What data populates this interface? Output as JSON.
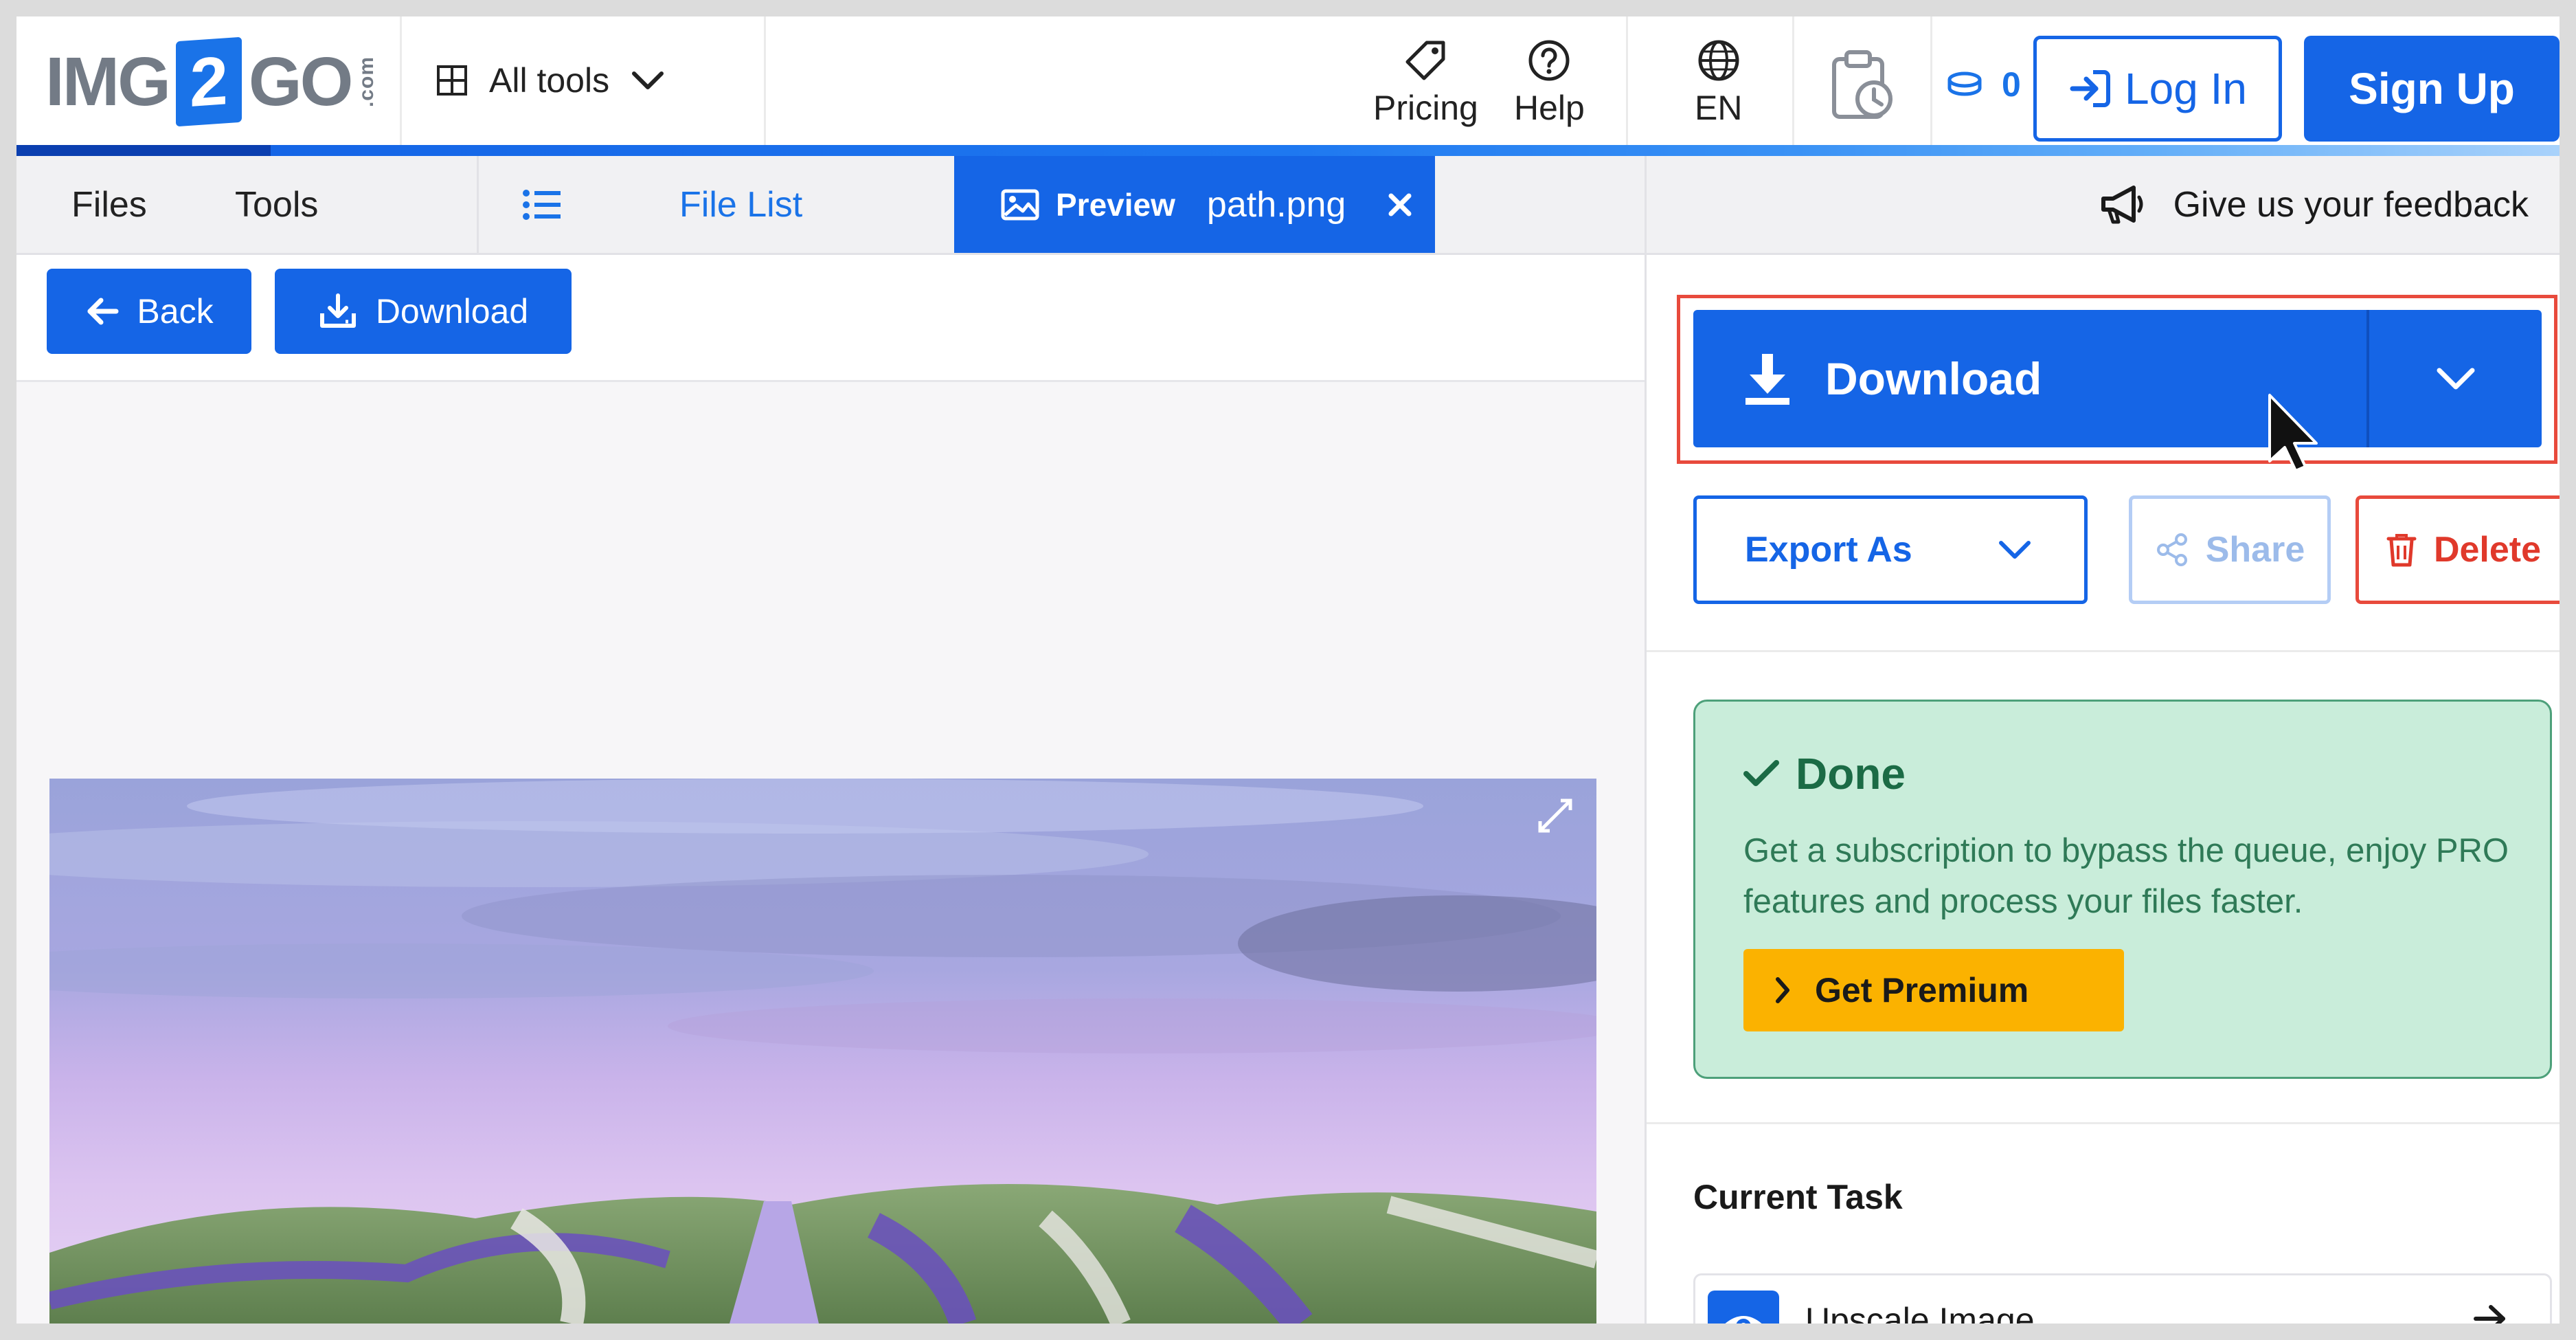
{
  "header": {
    "logo": {
      "pre": "IMG",
      "box": "2",
      "post": "GO",
      "suffix": ".com"
    },
    "all_tools_label": "All tools",
    "pricing_label": "Pricing",
    "help_label": "Help",
    "language_label": "EN",
    "credits_count": "0",
    "login_label": "Log In",
    "signup_label": "Sign Up"
  },
  "tabbar": {
    "files_label": "Files",
    "tools_label": "Tools",
    "file_list_label": "File List",
    "preview_label": "Preview",
    "preview_filename": "path.png",
    "feedback_label": "Give us your feedback"
  },
  "left_toolbar": {
    "back_label": "Back",
    "download_label": "Download"
  },
  "right_panel": {
    "download_label": "Download",
    "export_label": "Export As",
    "share_label": "Share",
    "delete_label": "Delete",
    "done": {
      "title": "Done",
      "message": "Get a subscription to bypass the queue, enjoy PRO features and process your files faster.",
      "premium_label": "Get Premium"
    },
    "current_task_heading": "Current Task",
    "task_label": "Upscale Image"
  },
  "colors": {
    "brand_blue": "#1565e6",
    "danger_red": "#e84a3c",
    "success_green": "#1b6b45",
    "premium_yellow": "#fbb200"
  }
}
